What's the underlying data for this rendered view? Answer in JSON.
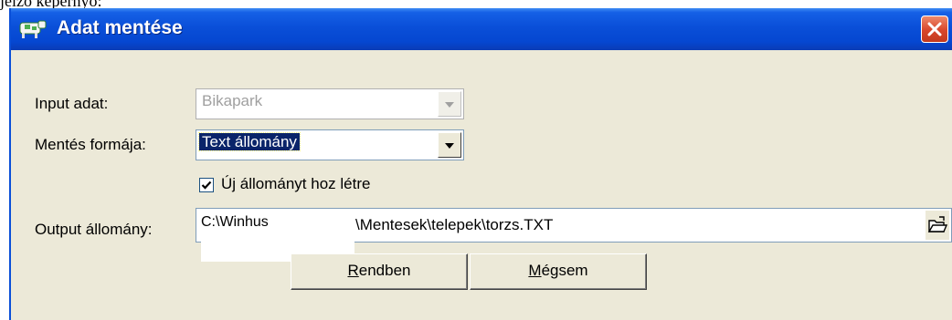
{
  "page_caption": "jelző képernyő:",
  "window": {
    "title": "Adat mentése",
    "icons": {
      "app": "cow-icon",
      "close": "close-x-icon"
    }
  },
  "form": {
    "input_label": "Input adat:",
    "input_value": "Bikapark",
    "format_label": "Mentés formája:",
    "format_value": "Text állomány",
    "new_file_checkbox": {
      "label": "Új állományt hoz létre",
      "checked": true
    },
    "output_label": "Output állomány:",
    "output_prefix": "C:\\Winhus",
    "output_suffix": "\\Mentesek\\telepek\\torzs.TXT",
    "browse_icon": "open-folder-icon"
  },
  "buttons": {
    "ok_first_letter": "R",
    "ok_rest": "endben",
    "cancel_first_letter": "M",
    "cancel_rest": "égsem"
  },
  "colors": {
    "title_bar": "#0a4fd8",
    "dialog_bg": "#ece9d8",
    "selection": "#0a246a",
    "close_button": "#d8462a"
  }
}
